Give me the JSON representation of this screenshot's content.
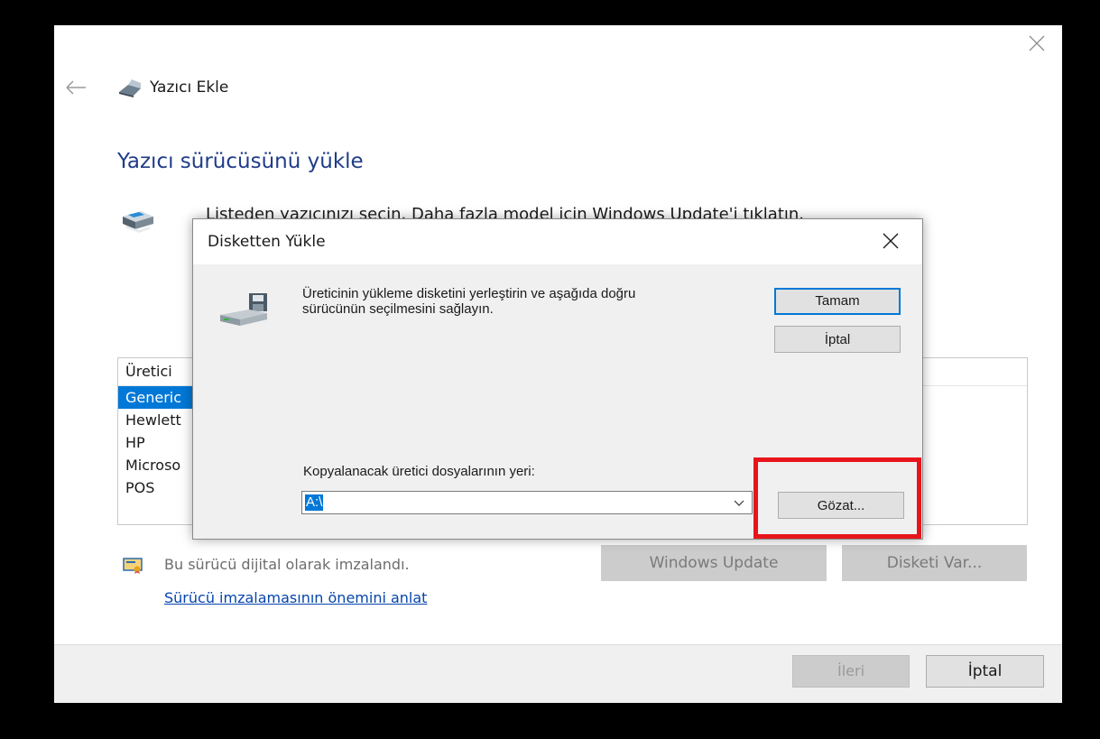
{
  "wizard": {
    "header_title": "Yazıcı Ekle",
    "page_title": "Yazıcı sürücüsünü yükle",
    "instruction": "Listeden yazıcınızı seçin. Daha fazla model için Windows Update'i tıklatın.",
    "manufacturer_list": {
      "header": "Üretici",
      "items": [
        "Generic",
        "Hewlett",
        "HP",
        "Microso",
        "POS"
      ],
      "selected_index": 0
    },
    "signature_text": "Bu sürücü dijital olarak imzalandı.",
    "signature_link": "Sürücü imzalamasının önemini anlat",
    "windows_update_label": "Windows Update",
    "have_disk_label": "Disketi Var...",
    "next_label": "İleri",
    "cancel_label": "İptal"
  },
  "dialog": {
    "title": "Disketten Yükle",
    "message": "Üreticinin yükleme disketini yerleştirin ve aşağıda doğru sürücünün seçilmesini sağlayın.",
    "ok_label": "Tamam",
    "cancel_label": "İptal",
    "path_label": "Kopyalanacak üretici dosyalarının yeri:",
    "path_value": "A:\\",
    "browse_label": "Gözat..."
  },
  "colors": {
    "accent": "#0078d7",
    "title_blue": "#1f3c88",
    "highlight_red": "#e8141b",
    "link": "#0645ad"
  },
  "icons": [
    "close-icon",
    "back-arrow-icon",
    "printer-icon",
    "floppy-drive-icon",
    "certificate-icon",
    "chevron-down-icon"
  ]
}
